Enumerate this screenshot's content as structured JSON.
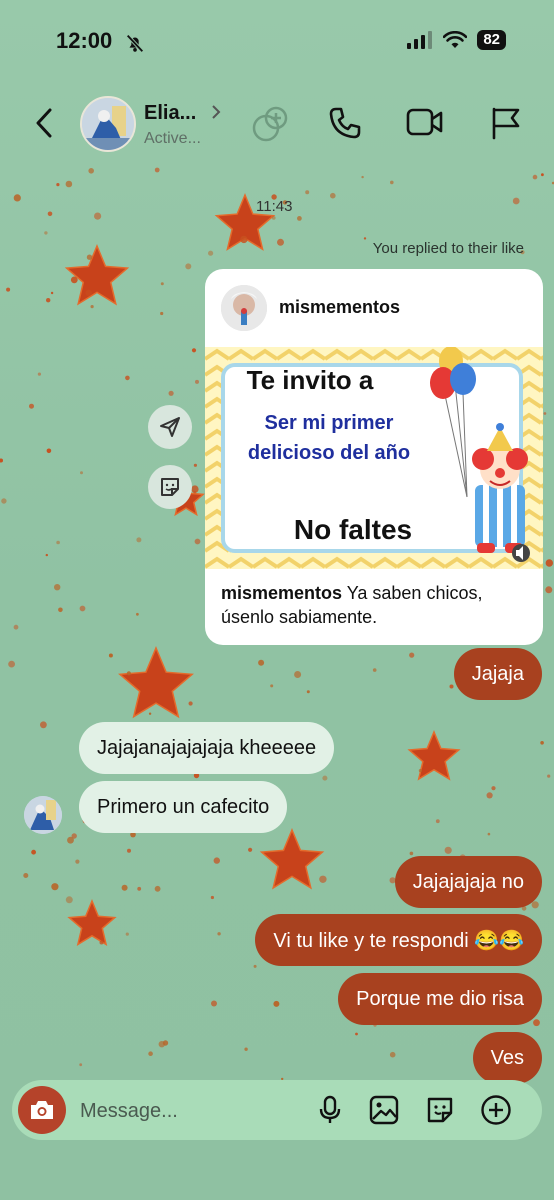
{
  "status_bar": {
    "time": "12:00",
    "battery": "82"
  },
  "header": {
    "name": "Elia...",
    "status": "Active..."
  },
  "thread": {
    "timestamp": "11:43",
    "reply_note": "You replied to their like"
  },
  "shared_post": {
    "username": "mismementos",
    "image_text": {
      "line1": "Te invito a",
      "line2": "Ser mi primer",
      "line3": "delicioso del año",
      "line4": "No faltes"
    },
    "caption_user": "mismementos",
    "caption_text": " Ya saben chicos, úsenlo sabiamente."
  },
  "messages": [
    {
      "id": "m1",
      "dir": "out",
      "text": "Jajaja"
    },
    {
      "id": "m2",
      "dir": "in",
      "text": "Jajajanajajajaja kheeeee"
    },
    {
      "id": "m3",
      "dir": "in",
      "text": "Primero un cafecito"
    },
    {
      "id": "m4",
      "dir": "out",
      "text": "Jajajajaja no"
    },
    {
      "id": "m5",
      "dir": "out",
      "text": "Vi tu like y te respondi 😂😂"
    },
    {
      "id": "m6",
      "dir": "out",
      "text": "Porque me dio risa"
    },
    {
      "id": "m7",
      "dir": "out",
      "text": "Ves"
    }
  ],
  "composer": {
    "placeholder": "Message..."
  },
  "icons": {
    "back": "back-arrow-icon",
    "add_people": "add-people-icon",
    "call": "phone-icon",
    "video": "video-camera-icon",
    "report": "flag-icon",
    "share": "share-icon",
    "sticker": "sticker-icon",
    "camera": "camera-icon",
    "mic": "microphone-icon",
    "gallery": "gallery-icon",
    "plus": "plus-icon"
  },
  "colors": {
    "background": "#93c4a6",
    "outgoing_bubble": "#a8411f",
    "incoming_bubble": "#e2f1e6",
    "composer": "#a9dcb8",
    "camera_button": "#b5432a"
  }
}
